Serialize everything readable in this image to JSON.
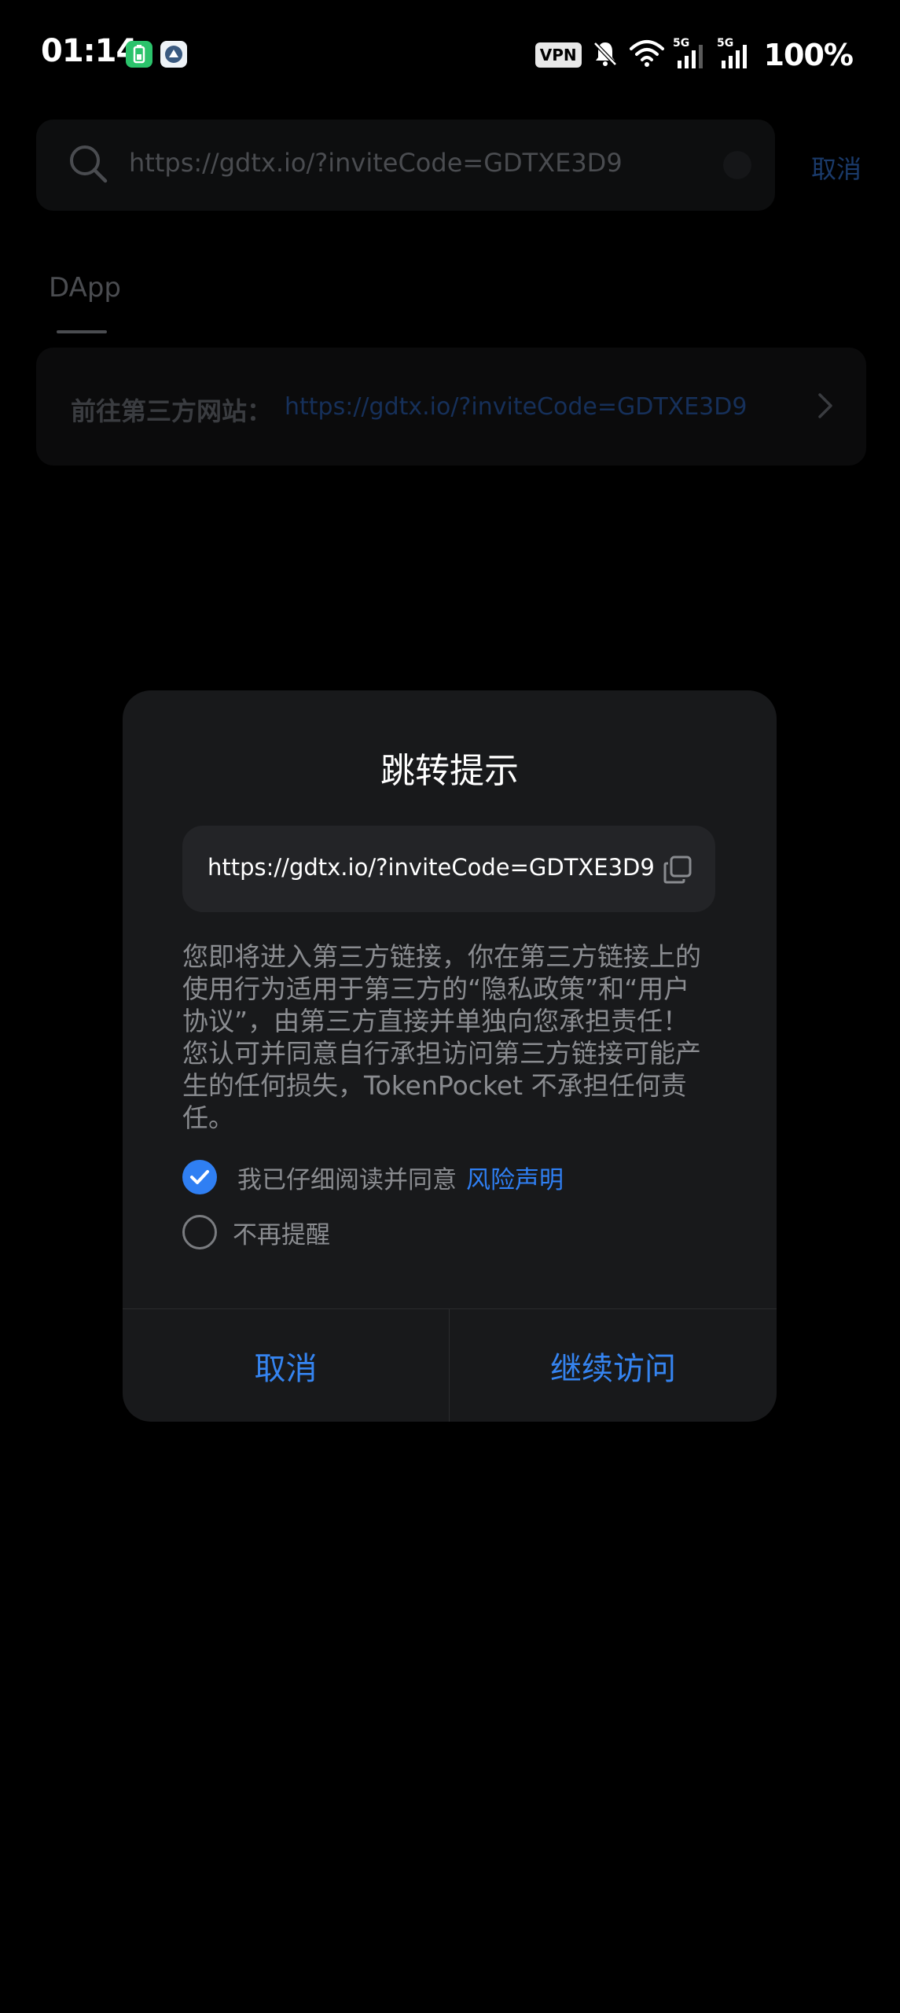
{
  "status_bar": {
    "time": "01:14",
    "vpn": "VPN",
    "battery": "100%",
    "network_type": "5G"
  },
  "background": {
    "search": {
      "value": "https://gdtx.io/?inviteCode=GDTXE3D9",
      "cancel_label": "取消"
    },
    "tabs": [
      {
        "label": "DApp"
      }
    ],
    "goto_card": {
      "label": "前往第三方网站：",
      "url": "https://gdtx.io/?inviteCode=GDTXE3D9"
    }
  },
  "dialog": {
    "title": "跳转提示",
    "url": "https://gdtx.io/?inviteCode=GDTXE3D9",
    "disclaimer": "您即将进入第三方链接，你在第三方链接上的使用行为适用于第三方的“隐私政策”和“用户协议”，由第三方直接并单独向您承担责任！您认可并同意自行承担访问第三方链接可能产生的任何损失，TokenPocket 不承担任何责任。",
    "agree": {
      "label": "我已仔细阅读并同意",
      "link": "风险声明",
      "checked": true
    },
    "no_remind": {
      "label": "不再提醒",
      "checked": false
    },
    "cancel_label": "取消",
    "continue_label": "继续访问"
  },
  "colors": {
    "accent": "#2f7ff3",
    "dialog_bg": "#18191b",
    "page_bg": "#000000"
  },
  "icons": {
    "search": "search-icon",
    "copy": "copy-icon",
    "check": "check-icon",
    "chevron": "chevron-right-icon",
    "wifi": "wifi-icon",
    "mute": "bell-off-icon"
  }
}
